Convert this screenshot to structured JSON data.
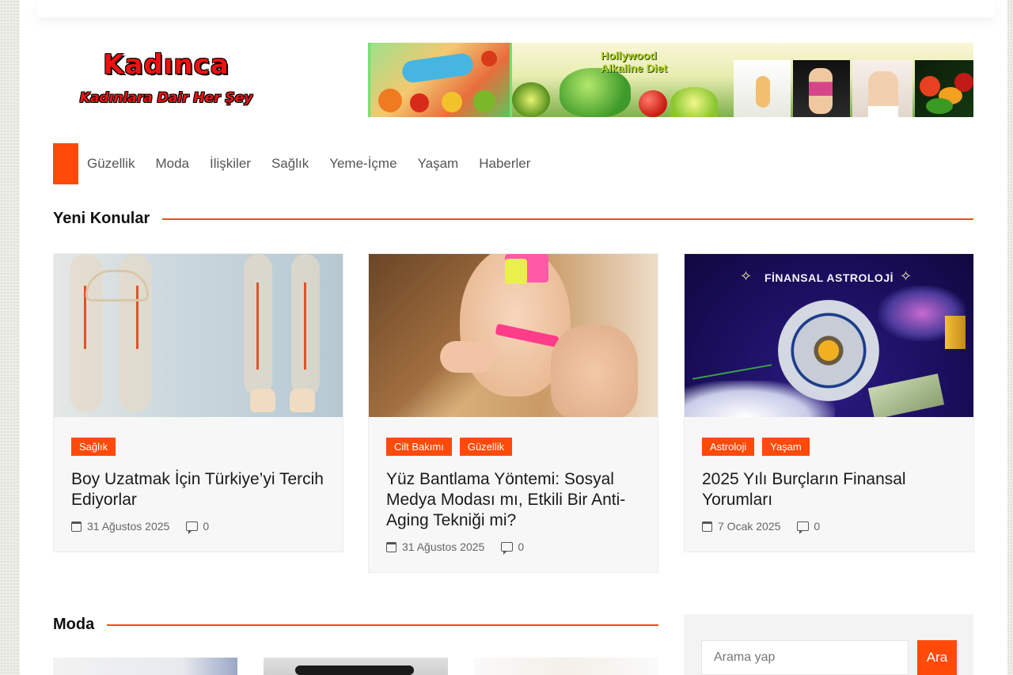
{
  "site": {
    "logo_title": "Kadınca",
    "logo_subtitle": "Kadınlara Dair Her Şey"
  },
  "banner": {
    "text": "Hollywood Alkaline Diet"
  },
  "nav": {
    "items": [
      "Güzellik",
      "Moda",
      "İlişkiler",
      "Sağlık",
      "Yeme-İçme",
      "Yaşam",
      "Haberler"
    ]
  },
  "sections": {
    "latest_title": "Yeni Konular",
    "moda_title": "Moda"
  },
  "cards": [
    {
      "tags": [
        "Sağlık"
      ],
      "title": "Boy Uzatmak İçin Türkiye’yi Tercih Ediyorlar",
      "date": "31 Ağustos 2025",
      "comments": "0"
    },
    {
      "tags": [
        "Cilt Bakımı",
        "Güzellik"
      ],
      "title": "Yüz Bantlama Yöntemi: Sosyal Medya Modası mı, Etkili Bir Anti-Aging Tekniği mi?",
      "date": "31 Ağustos 2025",
      "comments": "0"
    },
    {
      "tags": [
        "Astroloji",
        "Yaşam"
      ],
      "title": "2025 Yılı Burçların Finansal Yorumları",
      "date": "7 Ocak 2025",
      "comments": "0",
      "image_text": "FİNANSAL ASTROLOJİ"
    }
  ],
  "search": {
    "placeholder": "Arama yap",
    "button_label": "Ara"
  },
  "colors": {
    "accent": "#ff4a0a"
  }
}
